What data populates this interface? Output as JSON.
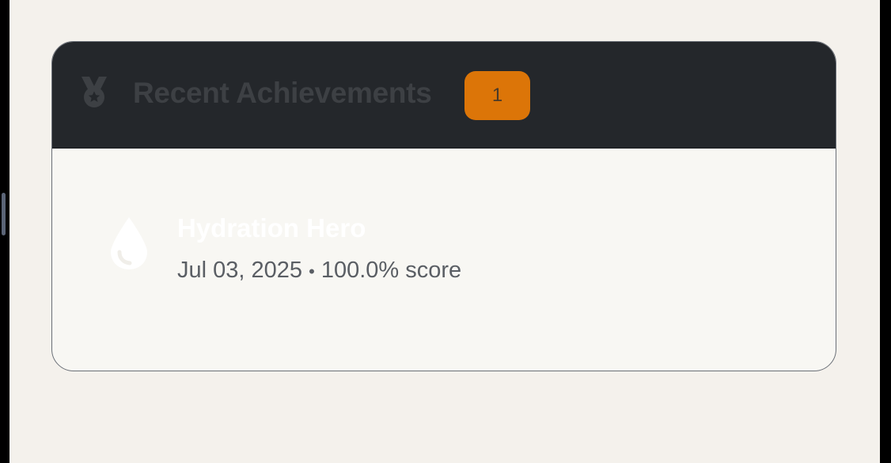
{
  "achievements_card": {
    "title": "Recent Achievements",
    "count": "1",
    "header_icon": "medal-icon",
    "items": [
      {
        "icon": "droplet-icon",
        "title": "Hydration Hero",
        "date": "Jul 03, 2025",
        "separator": "•",
        "score": "100.0% score"
      }
    ]
  },
  "colors": {
    "page_background": "#f4f1ec",
    "header_background": "#24272b",
    "badge_background": "#dc7508",
    "card_body": "#f8f7f3"
  }
}
